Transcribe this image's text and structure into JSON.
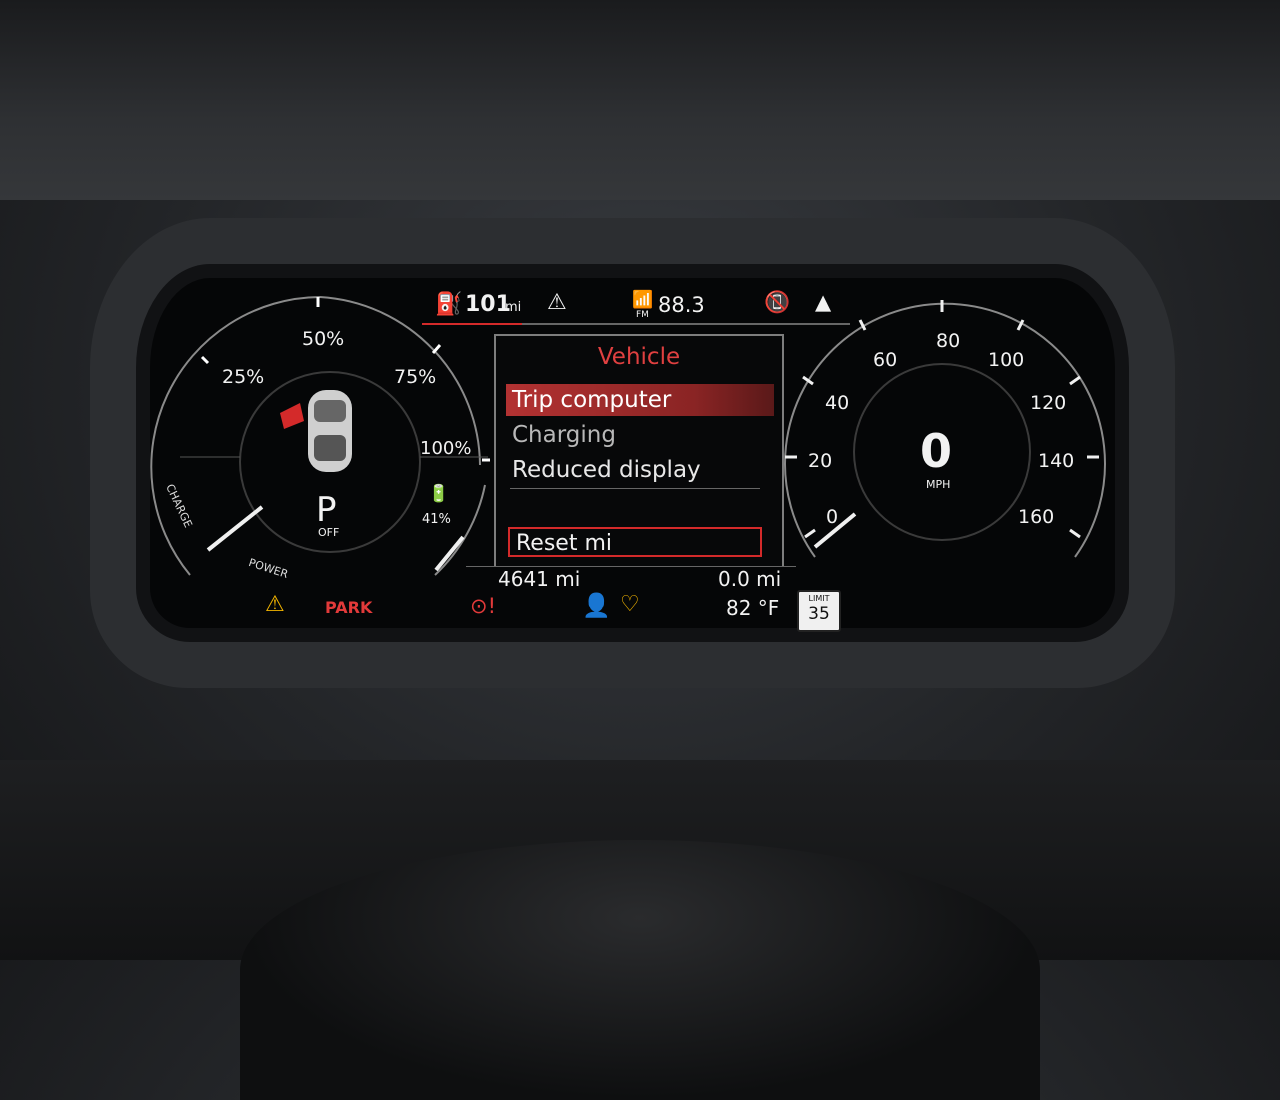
{
  "top_bar": {
    "range_value": "101",
    "range_unit": "mi",
    "radio_band": "FM",
    "radio_freq": "88.3"
  },
  "menu": {
    "title": "Vehicle",
    "items": [
      {
        "label": "Trip computer",
        "selected": true
      },
      {
        "label": "Charging",
        "selected": false
      },
      {
        "label": "Reduced display",
        "selected": false
      }
    ],
    "action_label": "Reset mi"
  },
  "left_gauge": {
    "ticks": [
      "25%",
      "50%",
      "75%",
      "100%"
    ],
    "charge_label": "CHARGE",
    "power_label": "POWER",
    "gear": "P",
    "gear_state": "OFF",
    "battery_percent": "41%"
  },
  "right_gauge": {
    "ticks": [
      "0",
      "20",
      "40",
      "60",
      "80",
      "100",
      "120",
      "140",
      "160"
    ],
    "speed": "0",
    "unit": "MPH"
  },
  "bottom_bar": {
    "odometer": "4641 mi",
    "trip": "0.0 mi",
    "temperature": "82 °F",
    "park_label": "PARK",
    "speed_limit_label": "LIMIT",
    "speed_limit_value": "35"
  },
  "colors": {
    "accent_red": "#d42a2a",
    "warning_amber": "#f2b400",
    "text_white": "#f2f2f2"
  }
}
